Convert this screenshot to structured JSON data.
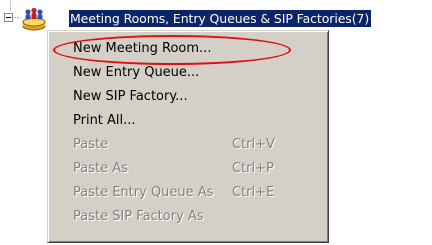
{
  "tree": {
    "node_label": "Meeting Rooms, Entry Queues & SIP Factories(7)",
    "node_icon": "people-group-icon",
    "expander_icon": "collapse-minus-icon"
  },
  "context_menu": {
    "items": [
      {
        "label": "New Meeting Room...",
        "shortcut": "",
        "enabled": true
      },
      {
        "label": "New Entry Queue...",
        "shortcut": "",
        "enabled": true
      },
      {
        "label": "New SIP Factory...",
        "shortcut": "",
        "enabled": true
      },
      {
        "label": "Print All...",
        "shortcut": "",
        "enabled": true
      },
      {
        "label": "Paste",
        "shortcut": "Ctrl+V",
        "enabled": false
      },
      {
        "label": "Paste As",
        "shortcut": "Ctrl+P",
        "enabled": false
      },
      {
        "label": "Paste Entry Queue As",
        "shortcut": "Ctrl+E",
        "enabled": false
      },
      {
        "label": "Paste SIP Factory As",
        "shortcut": "",
        "enabled": false
      }
    ]
  },
  "annotation": {
    "highlighted_item": "New Meeting Room...",
    "color": "#e01010"
  },
  "colors": {
    "selection_bg": "#0a246a",
    "menu_bg": "#d4d0c8",
    "disabled_text": "#808080"
  }
}
